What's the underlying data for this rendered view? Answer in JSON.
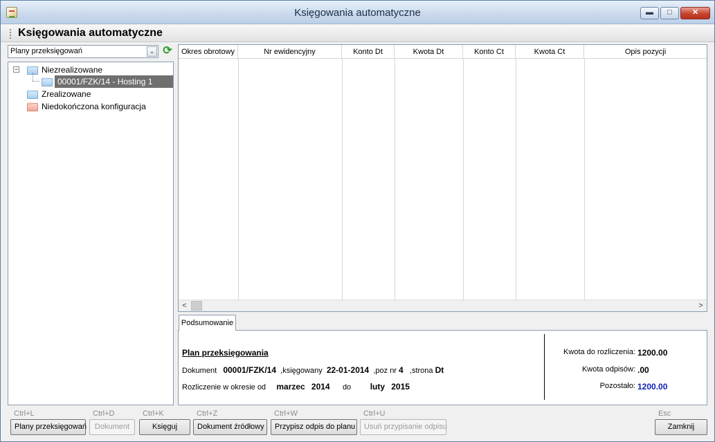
{
  "window": {
    "title": "Księgowania automatyczne",
    "minimize": "▬",
    "maximize": "□",
    "close": "✕"
  },
  "header": {
    "title": "Księgowania automatyczne"
  },
  "combo": {
    "value": "Plany przeksięgowań",
    "arrow": "⌄"
  },
  "tree": {
    "items": [
      {
        "label": "Niezrealizowane",
        "expander": "−",
        "icon": "folder-icon"
      },
      {
        "label": "00001/FZK/14 - Hosting 1",
        "icon": "folder-icon",
        "selected": true
      },
      {
        "label": "Zrealizowane",
        "icon": "folder-icon"
      },
      {
        "label": "Niedokończona konfiguracja",
        "icon": "folder-icon"
      }
    ]
  },
  "grid": {
    "columns": [
      "Okres obrotowy",
      "Nr ewidencyjny",
      "Konto Dt",
      "Kwota Dt",
      "Konto Ct",
      "Kwota Ct",
      "Opis pozycji"
    ],
    "scroll_left": "<",
    "scroll_right": ">"
  },
  "tabs": {
    "summary": "Podsumowanie"
  },
  "summary": {
    "plan_title": "Plan przeksięgowania",
    "doc_label": "Dokument",
    "doc_value": "00001/FZK/14",
    "posted_label": ",księgowany",
    "posted_date": "22-01-2014",
    "pos_label": ",poz nr",
    "pos_value": "4",
    "side_label": ",strona",
    "side_value": "Dt",
    "period_label": "Rozliczenie w okresie od",
    "from_month": "marzec",
    "from_year": "2014",
    "to_label": "do",
    "to_month": "luty",
    "to_year": "2015",
    "amount_label": "Kwota do rozliczenia:",
    "amount_value": "1200.00",
    "writeoffs_label": "Kwota odpisów:",
    "writeoffs_value": ".00",
    "remaining_label": "Pozostało:",
    "remaining_value": "1200.00"
  },
  "buttons": [
    {
      "shortcut": "Ctrl+L",
      "label": "Plany przeksięgowań",
      "enabled": true
    },
    {
      "shortcut": "Ctrl+D",
      "label": "Dokument",
      "enabled": false
    },
    {
      "shortcut": "Ctrl+K",
      "label": "Księguj",
      "enabled": true
    },
    {
      "shortcut": "Ctrl+Z",
      "label": "Dokument źródłowy",
      "enabled": true
    },
    {
      "shortcut": "Ctrl+W",
      "label": "Przypisz odpis do planu",
      "enabled": true
    },
    {
      "shortcut": "Ctrl+U",
      "label": "Usuń przypisanie odpisu",
      "enabled": false
    },
    {
      "shortcut": "Esc",
      "label": "Zamknij",
      "enabled": true
    }
  ],
  "colors": {
    "accent_blue": "#1020b0",
    "selection": "#6f6f6f"
  }
}
